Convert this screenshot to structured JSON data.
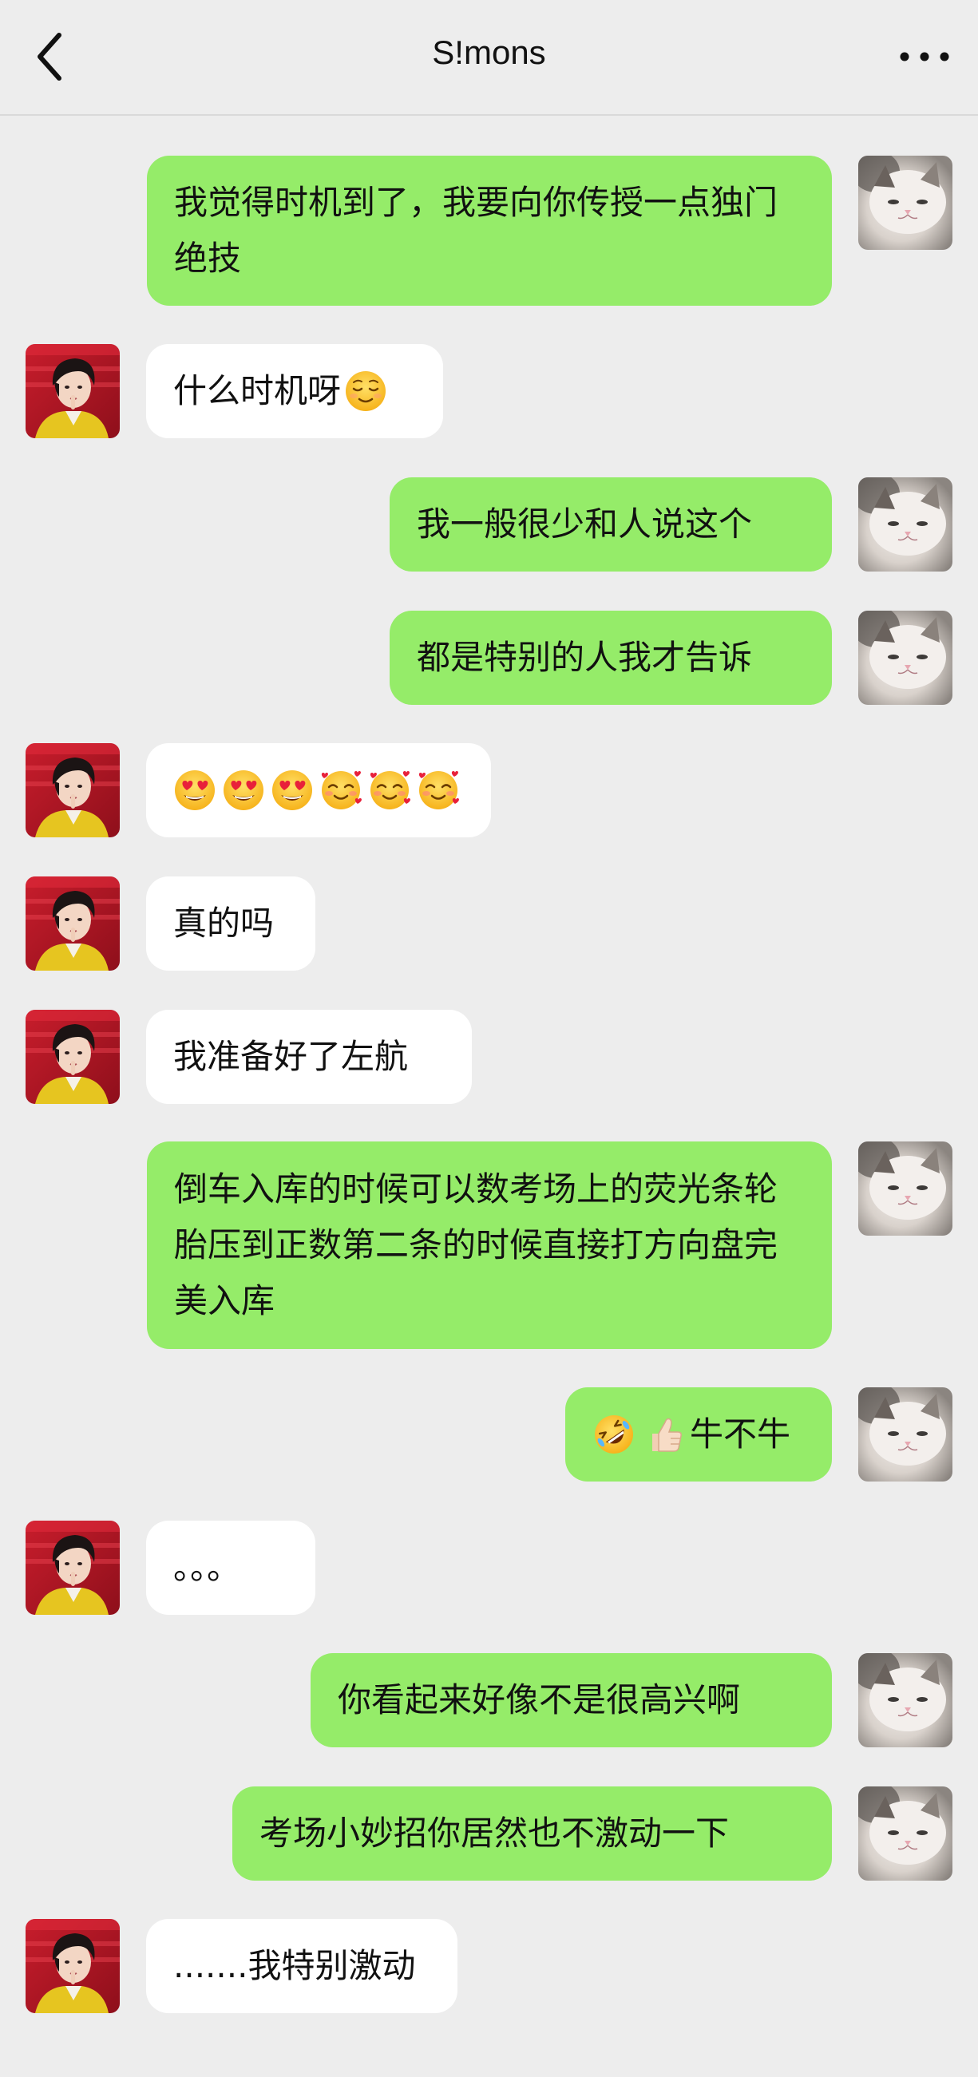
{
  "header": {
    "back_icon": "chevron-left-icon",
    "title": "S!mons",
    "more_icon": "more-dots-icon"
  },
  "colors": {
    "background": "#ededed",
    "incoming_bubble": "#ffffff",
    "outgoing_bubble": "#95ec69",
    "text": "#111111"
  },
  "messages": [
    {
      "side": "out",
      "avatar": "cat-avatar",
      "text": "我觉得时机到了，我要向你传授一点独门绝技"
    },
    {
      "side": "in",
      "avatar": "contact-avatar",
      "text": "什么时机呀",
      "emoji": [
        "relieved-face-icon"
      ]
    },
    {
      "side": "out",
      "avatar": "cat-avatar",
      "text": "我一般很少和人说这个"
    },
    {
      "side": "out",
      "avatar": "cat-avatar",
      "text": "都是特别的人我才告诉"
    },
    {
      "side": "in",
      "avatar": "contact-avatar",
      "emoji": [
        "heart-eyes-face-icon",
        "heart-eyes-face-icon",
        "heart-eyes-face-icon",
        "smiling-face-with-hearts-icon",
        "smiling-face-with-hearts-icon",
        "smiling-face-with-hearts-icon"
      ]
    },
    {
      "side": "in",
      "avatar": "contact-avatar",
      "text": "真的吗"
    },
    {
      "side": "in",
      "avatar": "contact-avatar",
      "text": "我准备好了左航"
    },
    {
      "side": "out",
      "avatar": "cat-avatar",
      "text": "倒车入库的时候可以数考场上的荧光条轮胎压到正数第二条的时候直接打方向盘完美入库"
    },
    {
      "side": "out",
      "avatar": "cat-avatar",
      "text": "牛不牛",
      "emoji_prefix": [
        "rolling-on-floor-laughing-icon",
        "thumbs-up-icon"
      ]
    },
    {
      "side": "in",
      "avatar": "contact-avatar",
      "text": "。。。"
    },
    {
      "side": "out",
      "avatar": "cat-avatar",
      "text": "你看起来好像不是很高兴啊"
    },
    {
      "side": "out",
      "avatar": "cat-avatar",
      "text": "考场小妙招你居然也不激动一下"
    },
    {
      "side": "in",
      "avatar": "contact-avatar",
      "text": ".......我特别激动"
    }
  ]
}
